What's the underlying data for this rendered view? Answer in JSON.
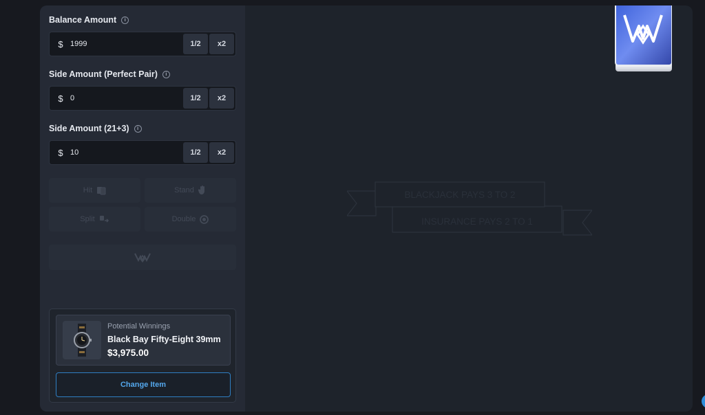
{
  "bet_panel": {
    "balance": {
      "label": "Balance Amount",
      "currency": "$",
      "value": "1999",
      "half_label": "1/2",
      "double_label": "x2"
    },
    "perfect_pair": {
      "label": "Side Amount (Perfect Pair)",
      "currency": "$",
      "value": "0",
      "half_label": "1/2",
      "double_label": "x2"
    },
    "twenty_one_plus_three": {
      "label": "Side Amount (21+3)",
      "currency": "$",
      "value": "10",
      "half_label": "1/2",
      "double_label": "x2"
    },
    "info_glyph": "i"
  },
  "actions": {
    "hit": "Hit",
    "stand": "Stand",
    "split": "Split",
    "double": "Double"
  },
  "winnings": {
    "label": "Potential Winnings",
    "item_name": "Black Bay Fifty-Eight 39mm",
    "amount": "$3,975.00",
    "change_label": "Change Item"
  },
  "table": {
    "banner_top": "BLACKJACK PAYS 3 TO 2",
    "banner_bottom": "INSURANCE PAYS 2 TO 1"
  },
  "colors": {
    "accent": "#54a7ec",
    "panel": "#252a35",
    "table": "#1e232b",
    "background": "#17191f"
  },
  "icons": {
    "info": "info-icon",
    "hit": "card-icon",
    "stand": "hand-icon",
    "split": "split-arrows-icon",
    "double": "chip-icon",
    "deal": "logo-icon",
    "deck": "card-deck-icon",
    "prize": "watch-icon"
  }
}
